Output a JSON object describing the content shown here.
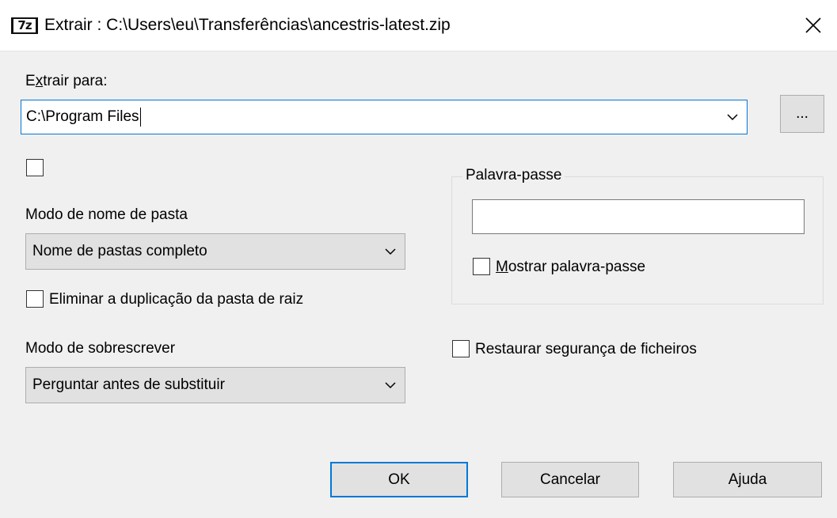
{
  "window": {
    "icon_text": "7z",
    "title": "Extrair : C:\\Users\\eu\\Transferências\\ancestris-latest.zip"
  },
  "extract_to": {
    "label_prefix": "E",
    "label_underlined": "x",
    "label_suffix": "trair para:",
    "path_value": "C:\\Program Files",
    "browse_label": "..."
  },
  "folder_mode": {
    "label": "Modo de nome de pasta",
    "selected": "Nome de pastas completo"
  },
  "eliminate_root": {
    "label": "Eliminar a duplicação da pasta de raiz"
  },
  "overwrite_mode": {
    "label": "Modo de sobrescrever",
    "selected": "Perguntar antes de substituir"
  },
  "password": {
    "group_title": "Palavra-passe",
    "value": "",
    "show_label_underlined": "M",
    "show_label_rest": "ostrar palavra-passe"
  },
  "restore_security": {
    "label": "Restaurar segurança de ficheiros"
  },
  "buttons": {
    "ok": "OK",
    "cancel": "Cancelar",
    "help": "Ajuda"
  }
}
